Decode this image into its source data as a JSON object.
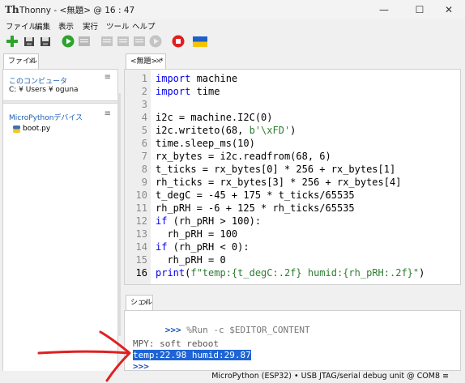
{
  "window": {
    "title": "Thonny  -  <無題>  @  16 : 47",
    "controls": {
      "minimize": "—",
      "maximize": "☐",
      "close": "✕"
    }
  },
  "menubar": [
    "ファイル",
    "編集",
    "表示",
    "実行",
    "ツール",
    "ヘルプ"
  ],
  "toolbar": {
    "icons": [
      "new-file-icon",
      "open-file-icon",
      "save-file-icon",
      "run-icon",
      "debug-icon",
      "step-over-icon",
      "step-into-icon",
      "step-out-icon",
      "resume-icon",
      "stop-icon",
      "ukraine-flag-icon"
    ]
  },
  "files_tab": {
    "label": "ファイル",
    "close": "×"
  },
  "editor_tab": {
    "label": "<無題> *",
    "close": "×"
  },
  "files": {
    "computer_section": {
      "title": "このコンピュータ",
      "path": "C: ¥ Users ¥ oguna",
      "menu": "≡"
    },
    "device_section": {
      "title": "MicroPythonデバイス",
      "menu": "≡",
      "items": [
        {
          "name": "boot.py",
          "icon": "python-file-icon"
        }
      ]
    }
  },
  "editor": {
    "line_numbers": [
      "1",
      "2",
      "3",
      "4",
      "5",
      "6",
      "7",
      "8",
      "9",
      "10",
      "11",
      "12",
      "13",
      "14",
      "15",
      "16"
    ],
    "lines": [
      "import machine",
      "import time",
      "",
      "i2c = machine.I2C(0)",
      "i2c.writeto(68, b'\\xFD')",
      "time.sleep_ms(10)",
      "rx_bytes = i2c.readfrom(68, 6)",
      "t_ticks = rx_bytes[0] * 256 + rx_bytes[1]",
      "rh_ticks = rx_bytes[3] * 256 + rx_bytes[4]",
      "t_degC = -45 + 175 * t_ticks/65535",
      "rh_pRH = -6 + 125 * rh_ticks/65535",
      "if (rh_pRH > 100):",
      "  rh_pRH = 100",
      "if (rh_pRH < 0):",
      "  rh_pRH = 0",
      "print(f\"temp:{t_degC:.2f} humid:{rh_pRH:.2f}\")"
    ]
  },
  "shell": {
    "tab_label": "シェル",
    "tab_close": "×",
    "command_prompt": ">>>",
    "command": " %Run -c $EDITOR_CONTENT",
    "output_line1": "MPY: soft reboot",
    "output_line2": "temp:22.98 humid:29.87",
    "next_prompt": ">>>"
  },
  "statusbar": {
    "text": "MicroPython (ESP32)  •  USB JTAG/serial debug unit @ COM8  ≡"
  },
  "colors": {
    "keyword": "#0000ee",
    "string": "#2e7d32",
    "highlight": "#1e64d6",
    "annotation": "#e02020"
  }
}
